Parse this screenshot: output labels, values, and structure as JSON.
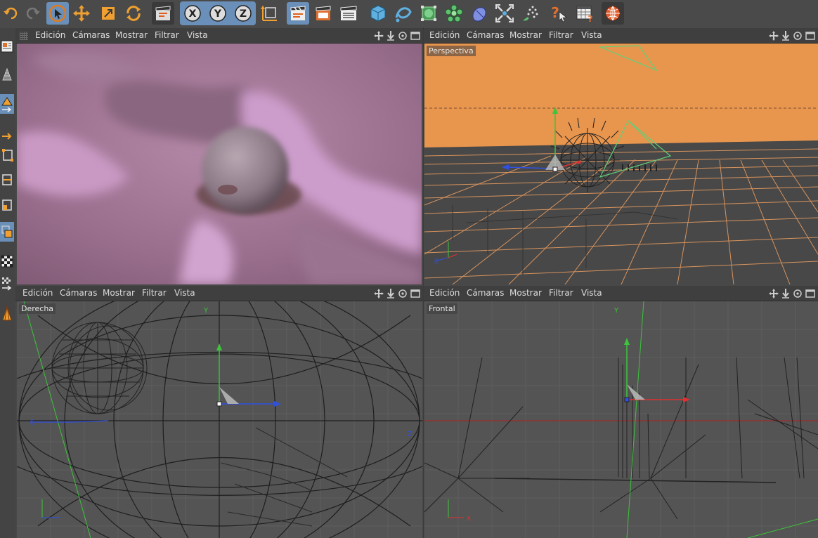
{
  "menu": {
    "edit": "Edición",
    "cameras": "Cámaras",
    "display": "Mostrar",
    "filter": "Filtrar",
    "view": "Vista"
  },
  "viewports": {
    "perspective_label": "Perspectiva",
    "right_label": "Derecha",
    "front_label": "Frontal"
  },
  "axes": {
    "x": "X",
    "y": "Y",
    "z": "Z"
  },
  "toolbar_icons": [
    "undo-icon",
    "redo-icon",
    "select-icon",
    "move-icon",
    "scale-icon",
    "rotate-icon",
    "render-region-icon",
    "x-axis-icon",
    "y-axis-icon",
    "z-axis-icon",
    "coordinate-system-icon",
    "render-view-icon",
    "render-picture-viewer-icon",
    "render-settings-icon",
    "cube-icon",
    "spline-icon",
    "nurbs-icon",
    "array-icon",
    "deformer-icon",
    "scene-icon",
    "particles-icon",
    "help-icon",
    "table-icon",
    "globe-icon"
  ],
  "colors": {
    "accent": "#6a8fb8",
    "persp_background": "#e8954e",
    "render_fur": "#b07aa2",
    "axis_x": "#e03030",
    "axis_y": "#3cc43c",
    "axis_z": "#3050e0"
  }
}
